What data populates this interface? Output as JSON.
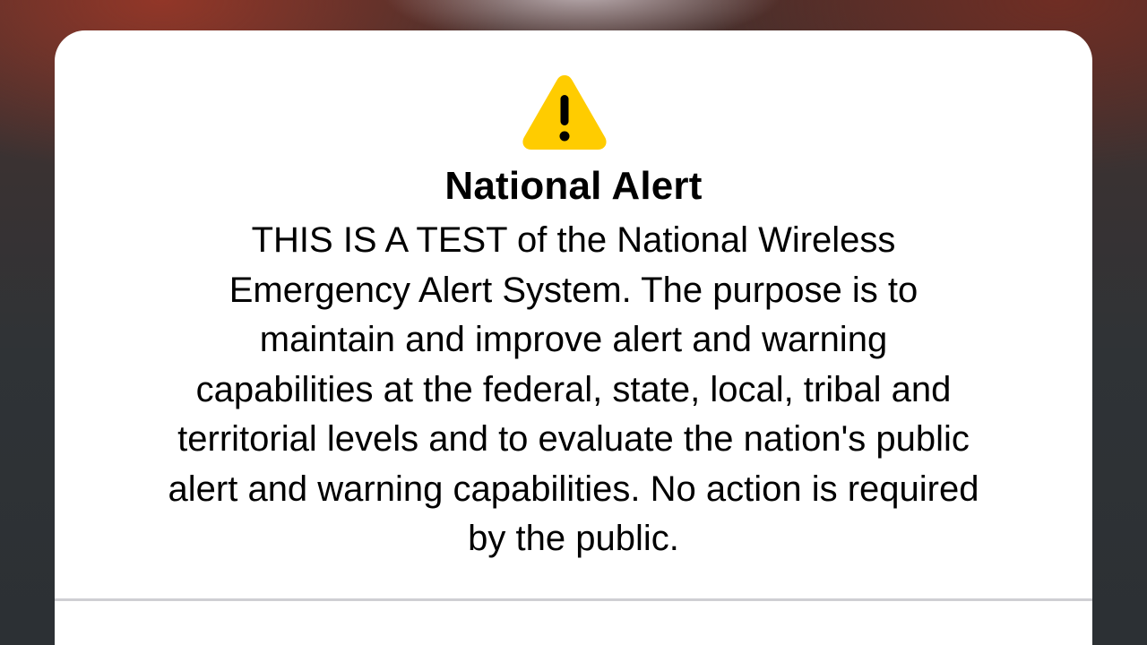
{
  "alert": {
    "icon": "warning-triangle-icon",
    "icon_color": "#FFCC00",
    "title": "National Alert",
    "message": "THIS IS A TEST of the National Wireless\nEmergency Alert System. The purpose is to\nmaintain and improve alert and warning\ncapabilities at the federal, state, local, tribal and\nterritorial levels and to evaluate the nation's public\nalert and warning capabilities. No action is required\nby the public."
  }
}
